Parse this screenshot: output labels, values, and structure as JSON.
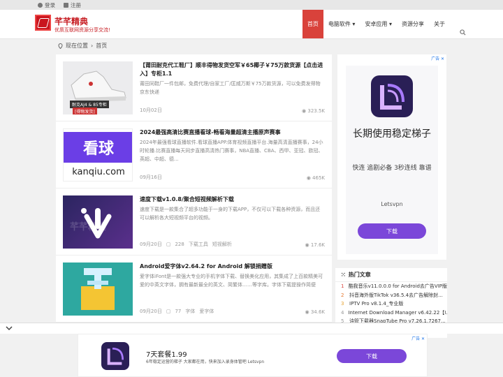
{
  "topbar": {
    "login": "登录",
    "register": "注册"
  },
  "site": {
    "title": "芊芊精典",
    "subtitle": "优质互联网资源分享交流!"
  },
  "nav": [
    {
      "label": "首页",
      "active": true
    },
    {
      "label": "电脑软件 ▾"
    },
    {
      "label": "安卓应用 ▾"
    },
    {
      "label": "资源分享"
    },
    {
      "label": "关于"
    }
  ],
  "breadcrumb": {
    "label": "现在位置",
    "home": "首页"
  },
  "posts": [
    {
      "title": "【莆田耐克代工鞋厂】顺丰得物发货空军￥65椰子￥75万款货源【点击进入】专柜1.1",
      "desc": "莆田同鞋厂一件包邮，免费代理/自家工厂/匡威万斯￥75万款货源，可以免费发得物京东快递",
      "date": "10月02日",
      "views": "323.5K",
      "thumb_caption": "耐克AJ4 & 85专柜",
      "thumb_badge": "[得物发货]"
    },
    {
      "title": "2024最强高清比赛直播看球-畅看海量超清主播原声赛事",
      "desc": "2024年最强看球直播软件.看球直播APP.体育视频直播平台.海量高清直播赛事，24小时轮播.比赛直播每天同步直播高清热门赛事，NBA直播、CBA、西甲、亚冠、欧冠、英超、中超、德...",
      "date": "09月16日",
      "views": "465K",
      "thumb_big": "看球",
      "thumb_url": "kanqiu.com"
    },
    {
      "title": "速度下载v1.0.8/聚合短视频解析下载",
      "desc": "速度下载是一款集合了超多功能于一身的下载APP，不仅可以下载各种资源，而且还可以解析各大短视频平台的视频。",
      "date": "09月20日",
      "comments": "228",
      "tag1": "下载工具",
      "tag2": "短视解析",
      "views": "17.6K",
      "thumb_watermark": "芊芊精典"
    },
    {
      "title": "Android爱字体v2.64.2 for Android 解锁捐赠版",
      "desc": "爱字体iFont是一款强大专业的手机字体下载、替换美化应用，其集成了上百款精美可爱的中英文字体，拥有最新最全的英文、简繁体……等字库。字体下载提操作简便",
      "date": "09月20日",
      "comments": "77",
      "tag1": "字体",
      "tag2": "爱字体",
      "views": "34.6K"
    }
  ],
  "ad_side": {
    "badge": "广告 ✕",
    "headline": "长期使用稳定梯子",
    "sub": "快连 追剧必备 3秒连线 靠谱",
    "brand": "Letsvpn",
    "button": "下载"
  },
  "hot": {
    "title": "热门文章",
    "items": [
      {
        "n": "1",
        "text": "酷我音乐v11.0.0.0 for Android去广告VIP版"
      },
      {
        "n": "2",
        "text": "抖音海外版TikTok v36.5.4去广告解除封..."
      },
      {
        "n": "3",
        "text": "IPTV Pro v8.1.4_专业版"
      },
      {
        "n": "4",
        "text": "Internet Download Manager v6.42.22【I..."
      },
      {
        "n": "5",
        "text": "油管下载器SnapTube Pro v7.26.1.7267..."
      }
    ]
  },
  "ad_bottom": {
    "badge": "广告 ✕",
    "headline": "7天套餐1.99",
    "sub": "6年稳定运营的梯子 大家都在用，快来加入录身体管吧 Letsvpn",
    "button": "下载"
  },
  "colors": {
    "brand": "#c71d23",
    "nav_active": "#d9423b",
    "ad_purple": "#7b47d9"
  }
}
